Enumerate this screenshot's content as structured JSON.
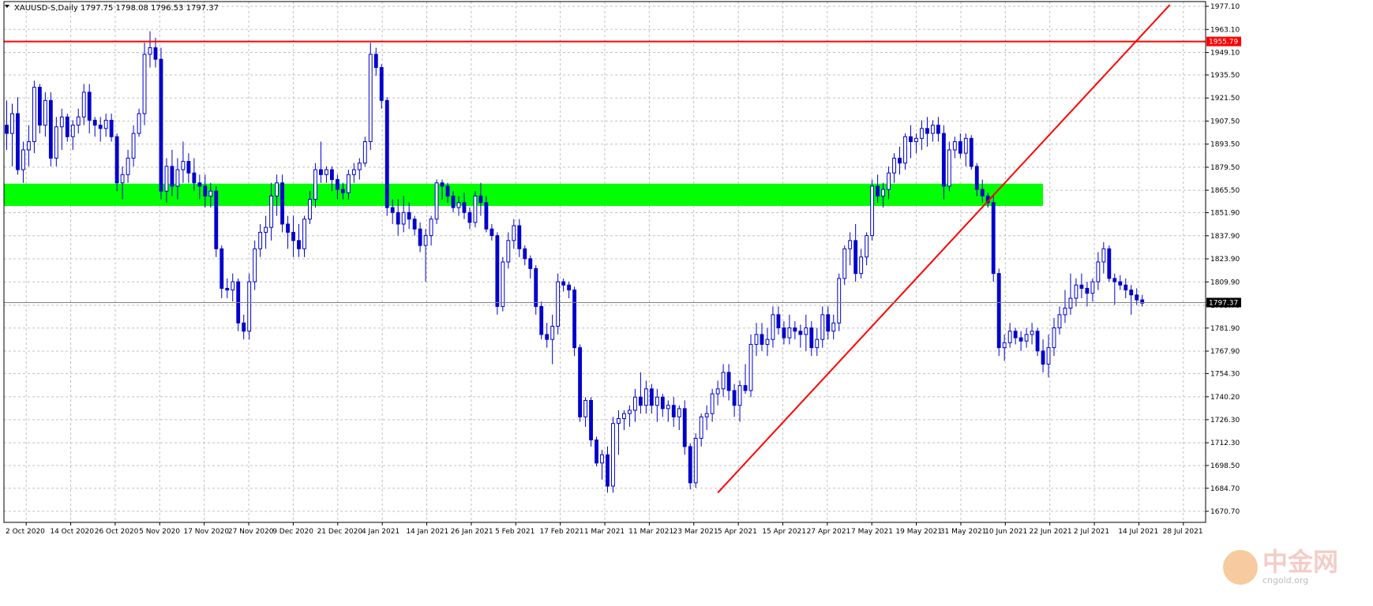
{
  "chart_data": {
    "type": "candlestick",
    "symbol_header": "XAUUSD-S,Daily  1797.75 1798.08 1796.53 1797.37",
    "y_ticks": [
      1670.7,
      1684.7,
      1698.5,
      1712.3,
      1726.3,
      1740.2,
      1754.3,
      1767.9,
      1781.9,
      1795.7,
      1809.9,
      1823.9,
      1837.9,
      1851.9,
      1865.5,
      1879.5,
      1893.5,
      1907.5,
      1921.5,
      1935.5,
      1949.1,
      1963.1,
      1977.1
    ],
    "y_tick_labels": [
      "1670.70",
      "1684.70",
      "1698.50",
      "1712.30",
      "1726.30",
      "1740.20",
      "1754.30",
      "1767.90",
      "1781.90",
      "1795.70",
      "1809.90",
      "1823.90",
      "1837.90",
      "1851.90",
      "1865.50",
      "1879.50",
      "1893.50",
      "1907.50",
      "1921.50",
      "1935.50",
      "1949.10",
      "1963.10",
      "1977.10"
    ],
    "ylim": [
      1664.0,
      1980.0
    ],
    "x_labels": [
      "2 Oct 2020",
      "14 Oct 2020",
      "26 Oct 2020",
      "5 Nov 2020",
      "17 Nov 2020",
      "27 Nov 2020",
      "9 Dec 2020",
      "21 Dec 2020",
      "4 Jan 2021",
      "14 Jan 2021",
      "26 Jan 2021",
      "5 Feb 2021",
      "17 Feb 2021",
      "1 Mar 2021",
      "11 Mar 2021",
      "23 Mar 2021",
      "5 Apr 2021",
      "15 Apr 2021",
      "27 Apr 2021",
      "7 May 2021",
      "19 May 2021",
      "31 May 2021",
      "10 Jun 2021",
      "22 Jun 2021",
      "2 Jul 2021",
      "14 Jul 2021",
      "28 Jul 2021"
    ],
    "num_bars": 218,
    "candles": [
      [
        1905,
        1920,
        1890,
        1900
      ],
      [
        1900,
        1918,
        1880,
        1912
      ],
      [
        1912,
        1922,
        1875,
        1878
      ],
      [
        1878,
        1895,
        1870,
        1890
      ],
      [
        1890,
        1905,
        1880,
        1895
      ],
      [
        1895,
        1932,
        1888,
        1928
      ],
      [
        1928,
        1930,
        1900,
        1905
      ],
      [
        1905,
        1925,
        1898,
        1920
      ],
      [
        1920,
        1925,
        1880,
        1885
      ],
      [
        1885,
        1910,
        1880,
        1904
      ],
      [
        1904,
        1915,
        1890,
        1910
      ],
      [
        1910,
        1912,
        1895,
        1898
      ],
      [
        1898,
        1908,
        1890,
        1905
      ],
      [
        1905,
        1915,
        1900,
        1910
      ],
      [
        1910,
        1930,
        1905,
        1925
      ],
      [
        1925,
        1930,
        1900,
        1908
      ],
      [
        1908,
        1910,
        1898,
        1905
      ],
      [
        1905,
        1910,
        1895,
        1903
      ],
      [
        1903,
        1912,
        1898,
        1908
      ],
      [
        1908,
        1912,
        1895,
        1898
      ],
      [
        1898,
        1900,
        1865,
        1870
      ],
      [
        1870,
        1880,
        1860,
        1875
      ],
      [
        1875,
        1890,
        1870,
        1885
      ],
      [
        1885,
        1905,
        1880,
        1900
      ],
      [
        1900,
        1915,
        1898,
        1912
      ],
      [
        1912,
        1955,
        1905,
        1948
      ],
      [
        1948,
        1962,
        1940,
        1952
      ],
      [
        1952,
        1958,
        1940,
        1945
      ],
      [
        1945,
        1952,
        1860,
        1865
      ],
      [
        1865,
        1885,
        1858,
        1880
      ],
      [
        1880,
        1890,
        1862,
        1868
      ],
      [
        1868,
        1885,
        1860,
        1878
      ],
      [
        1878,
        1895,
        1870,
        1883
      ],
      [
        1883,
        1888,
        1870,
        1876
      ],
      [
        1876,
        1885,
        1865,
        1870
      ],
      [
        1870,
        1875,
        1860,
        1868
      ],
      [
        1868,
        1875,
        1855,
        1862
      ],
      [
        1862,
        1870,
        1855,
        1865
      ],
      [
        1865,
        1868,
        1825,
        1830
      ],
      [
        1830,
        1832,
        1800,
        1806
      ],
      [
        1806,
        1812,
        1800,
        1805
      ],
      [
        1805,
        1815,
        1798,
        1810
      ],
      [
        1810,
        1812,
        1780,
        1785
      ],
      [
        1785,
        1790,
        1775,
        1780
      ],
      [
        1780,
        1815,
        1775,
        1810
      ],
      [
        1810,
        1835,
        1805,
        1830
      ],
      [
        1830,
        1845,
        1825,
        1840
      ],
      [
        1840,
        1850,
        1830,
        1843
      ],
      [
        1843,
        1870,
        1835,
        1862
      ],
      [
        1862,
        1875,
        1850,
        1870
      ],
      [
        1870,
        1875,
        1840,
        1845
      ],
      [
        1845,
        1850,
        1830,
        1840
      ],
      [
        1840,
        1850,
        1825,
        1835
      ],
      [
        1835,
        1845,
        1825,
        1830
      ],
      [
        1830,
        1850,
        1825,
        1848
      ],
      [
        1848,
        1865,
        1845,
        1860
      ],
      [
        1860,
        1882,
        1855,
        1878
      ],
      [
        1878,
        1895,
        1870,
        1875
      ],
      [
        1875,
        1880,
        1870,
        1878
      ],
      [
        1878,
        1880,
        1865,
        1872
      ],
      [
        1872,
        1875,
        1860,
        1866
      ],
      [
        1866,
        1870,
        1860,
        1864
      ],
      [
        1864,
        1878,
        1860,
        1875
      ],
      [
        1875,
        1882,
        1870,
        1878
      ],
      [
        1878,
        1885,
        1872,
        1882
      ],
      [
        1882,
        1898,
        1880,
        1895
      ],
      [
        1895,
        1955,
        1890,
        1948
      ],
      [
        1948,
        1952,
        1935,
        1940
      ],
      [
        1940,
        1942,
        1915,
        1920
      ],
      [
        1920,
        1922,
        1850,
        1855
      ],
      [
        1855,
        1860,
        1845,
        1852
      ],
      [
        1852,
        1860,
        1838,
        1845
      ],
      [
        1845,
        1862,
        1840,
        1852
      ],
      [
        1852,
        1858,
        1842,
        1848
      ],
      [
        1848,
        1850,
        1838,
        1842
      ],
      [
        1842,
        1846,
        1828,
        1832
      ],
      [
        1832,
        1842,
        1810,
        1838
      ],
      [
        1838,
        1850,
        1832,
        1848
      ],
      [
        1848,
        1872,
        1845,
        1870
      ],
      [
        1870,
        1872,
        1860,
        1868
      ],
      [
        1868,
        1870,
        1858,
        1862
      ],
      [
        1862,
        1865,
        1852,
        1855
      ],
      [
        1855,
        1862,
        1850,
        1858
      ],
      [
        1858,
        1864,
        1848,
        1852
      ],
      [
        1852,
        1855,
        1842,
        1846
      ],
      [
        1846,
        1865,
        1843,
        1862
      ],
      [
        1862,
        1870,
        1850,
        1858
      ],
      [
        1858,
        1862,
        1840,
        1842
      ],
      [
        1842,
        1845,
        1835,
        1838
      ],
      [
        1838,
        1840,
        1790,
        1795
      ],
      [
        1795,
        1825,
        1792,
        1822
      ],
      [
        1822,
        1840,
        1818,
        1835
      ],
      [
        1835,
        1848,
        1830,
        1844
      ],
      [
        1844,
        1848,
        1825,
        1830
      ],
      [
        1830,
        1832,
        1820,
        1824
      ],
      [
        1824,
        1826,
        1812,
        1818
      ],
      [
        1818,
        1820,
        1790,
        1795
      ],
      [
        1795,
        1798,
        1775,
        1778
      ],
      [
        1778,
        1785,
        1770,
        1775
      ],
      [
        1775,
        1790,
        1760,
        1783
      ],
      [
        1783,
        1815,
        1778,
        1810
      ],
      [
        1810,
        1812,
        1804,
        1808
      ],
      [
        1808,
        1810,
        1800,
        1805
      ],
      [
        1805,
        1807,
        1765,
        1770
      ],
      [
        1770,
        1772,
        1725,
        1728
      ],
      [
        1728,
        1740,
        1722,
        1738
      ],
      [
        1738,
        1740,
        1710,
        1714
      ],
      [
        1714,
        1716,
        1698,
        1700
      ],
      [
        1700,
        1708,
        1690,
        1705
      ],
      [
        1705,
        1710,
        1682,
        1686
      ],
      [
        1686,
        1728,
        1682,
        1724
      ],
      [
        1724,
        1732,
        1705,
        1727
      ],
      [
        1727,
        1732,
        1720,
        1730
      ],
      [
        1730,
        1735,
        1722,
        1732
      ],
      [
        1732,
        1745,
        1725,
        1740
      ],
      [
        1740,
        1755,
        1730,
        1735
      ],
      [
        1735,
        1750,
        1730,
        1745
      ],
      [
        1745,
        1748,
        1730,
        1735
      ],
      [
        1735,
        1745,
        1725,
        1740
      ],
      [
        1740,
        1742,
        1728,
        1733
      ],
      [
        1733,
        1738,
        1725,
        1735
      ],
      [
        1735,
        1740,
        1722,
        1728
      ],
      [
        1728,
        1735,
        1720,
        1733
      ],
      [
        1733,
        1738,
        1705,
        1710
      ],
      [
        1710,
        1712,
        1684,
        1688
      ],
      [
        1688,
        1718,
        1685,
        1715
      ],
      [
        1715,
        1730,
        1710,
        1728
      ],
      [
        1728,
        1735,
        1720,
        1730
      ],
      [
        1730,
        1745,
        1725,
        1742
      ],
      [
        1742,
        1750,
        1735,
        1745
      ],
      [
        1745,
        1760,
        1740,
        1755
      ],
      [
        1755,
        1760,
        1738,
        1744
      ],
      [
        1744,
        1748,
        1728,
        1735
      ],
      [
        1735,
        1750,
        1725,
        1747
      ],
      [
        1747,
        1760,
        1742,
        1744
      ],
      [
        1744,
        1778,
        1740,
        1772
      ],
      [
        1772,
        1785,
        1765,
        1778
      ],
      [
        1778,
        1785,
        1768,
        1772
      ],
      [
        1772,
        1782,
        1765,
        1775
      ],
      [
        1775,
        1795,
        1770,
        1790
      ],
      [
        1790,
        1795,
        1778,
        1782
      ],
      [
        1782,
        1786,
        1772,
        1776
      ],
      [
        1776,
        1790,
        1772,
        1782
      ],
      [
        1782,
        1786,
        1775,
        1780
      ],
      [
        1780,
        1784,
        1770,
        1778
      ],
      [
        1778,
        1790,
        1768,
        1782
      ],
      [
        1782,
        1786,
        1765,
        1770
      ],
      [
        1770,
        1782,
        1765,
        1775
      ],
      [
        1775,
        1795,
        1770,
        1790
      ],
      [
        1790,
        1795,
        1775,
        1780
      ],
      [
        1780,
        1790,
        1775,
        1785
      ],
      [
        1785,
        1815,
        1780,
        1812
      ],
      [
        1812,
        1832,
        1808,
        1830
      ],
      [
        1830,
        1840,
        1820,
        1835
      ],
      [
        1835,
        1845,
        1810,
        1815
      ],
      [
        1815,
        1830,
        1812,
        1825
      ],
      [
        1825,
        1840,
        1820,
        1838
      ],
      [
        1838,
        1872,
        1835,
        1868
      ],
      [
        1868,
        1875,
        1858,
        1862
      ],
      [
        1862,
        1870,
        1855,
        1866
      ],
      [
        1866,
        1880,
        1860,
        1876
      ],
      [
        1876,
        1888,
        1870,
        1885
      ],
      [
        1885,
        1892,
        1875,
        1882
      ],
      [
        1882,
        1900,
        1878,
        1898
      ],
      [
        1898,
        1905,
        1885,
        1895
      ],
      [
        1895,
        1900,
        1888,
        1897
      ],
      [
        1897,
        1908,
        1890,
        1903
      ],
      [
        1903,
        1910,
        1892,
        1900
      ],
      [
        1900,
        1908,
        1895,
        1905
      ],
      [
        1905,
        1910,
        1895,
        1900
      ],
      [
        1900,
        1905,
        1860,
        1868
      ],
      [
        1868,
        1895,
        1865,
        1890
      ],
      [
        1890,
        1898,
        1885,
        1895
      ],
      [
        1895,
        1900,
        1885,
        1888
      ],
      [
        1888,
        1900,
        1880,
        1897
      ],
      [
        1897,
        1899,
        1878,
        1880
      ],
      [
        1880,
        1882,
        1862,
        1866
      ],
      [
        1866,
        1872,
        1858,
        1862
      ],
      [
        1862,
        1864,
        1855,
        1858
      ],
      [
        1858,
        1862,
        1810,
        1815
      ],
      [
        1815,
        1818,
        1765,
        1770
      ],
      [
        1770,
        1778,
        1762,
        1773
      ],
      [
        1773,
        1785,
        1770,
        1780
      ],
      [
        1780,
        1782,
        1772,
        1776
      ],
      [
        1776,
        1780,
        1768,
        1774
      ],
      [
        1774,
        1782,
        1770,
        1778
      ],
      [
        1778,
        1785,
        1772,
        1780
      ],
      [
        1780,
        1782,
        1765,
        1768
      ],
      [
        1768,
        1775,
        1755,
        1760
      ],
      [
        1760,
        1778,
        1752,
        1770
      ],
      [
        1770,
        1788,
        1765,
        1782
      ],
      [
        1782,
        1795,
        1778,
        1790
      ],
      [
        1790,
        1805,
        1785,
        1794
      ],
      [
        1794,
        1815,
        1790,
        1800
      ],
      [
        1800,
        1812,
        1795,
        1808
      ],
      [
        1808,
        1815,
        1800,
        1806
      ],
      [
        1806,
        1810,
        1795,
        1803
      ],
      [
        1803,
        1812,
        1798,
        1810
      ],
      [
        1810,
        1828,
        1805,
        1822
      ],
      [
        1822,
        1834,
        1815,
        1830
      ],
      [
        1830,
        1832,
        1810,
        1812
      ],
      [
        1812,
        1815,
        1796,
        1810
      ],
      [
        1810,
        1814,
        1805,
        1808
      ],
      [
        1808,
        1812,
        1800,
        1805
      ],
      [
        1805,
        1808,
        1790,
        1802
      ],
      [
        1802,
        1806,
        1796,
        1799
      ],
      [
        1799,
        1802,
        1795,
        1797
      ]
    ],
    "support_zone": {
      "low": 1856.0,
      "high": 1869.5,
      "color": "#00ff00"
    },
    "resistance_line": {
      "price": 1955.79,
      "label": "1955.79",
      "color": "#ff0000"
    },
    "trendline": {
      "from": {
        "date": "30 Mar 2021",
        "price": 1682.0
      },
      "to": {
        "date": "22 Jul 2021",
        "price": 1978.0
      },
      "color": "#ff0000"
    },
    "current_price": {
      "price": 1797.37,
      "label": "1797.37"
    },
    "colors": {
      "candle": "#0000cc",
      "grid": "#c0c0c0",
      "axis": "#000000"
    }
  },
  "watermark": {
    "brand": "中金网",
    "url": "cngold.org"
  }
}
